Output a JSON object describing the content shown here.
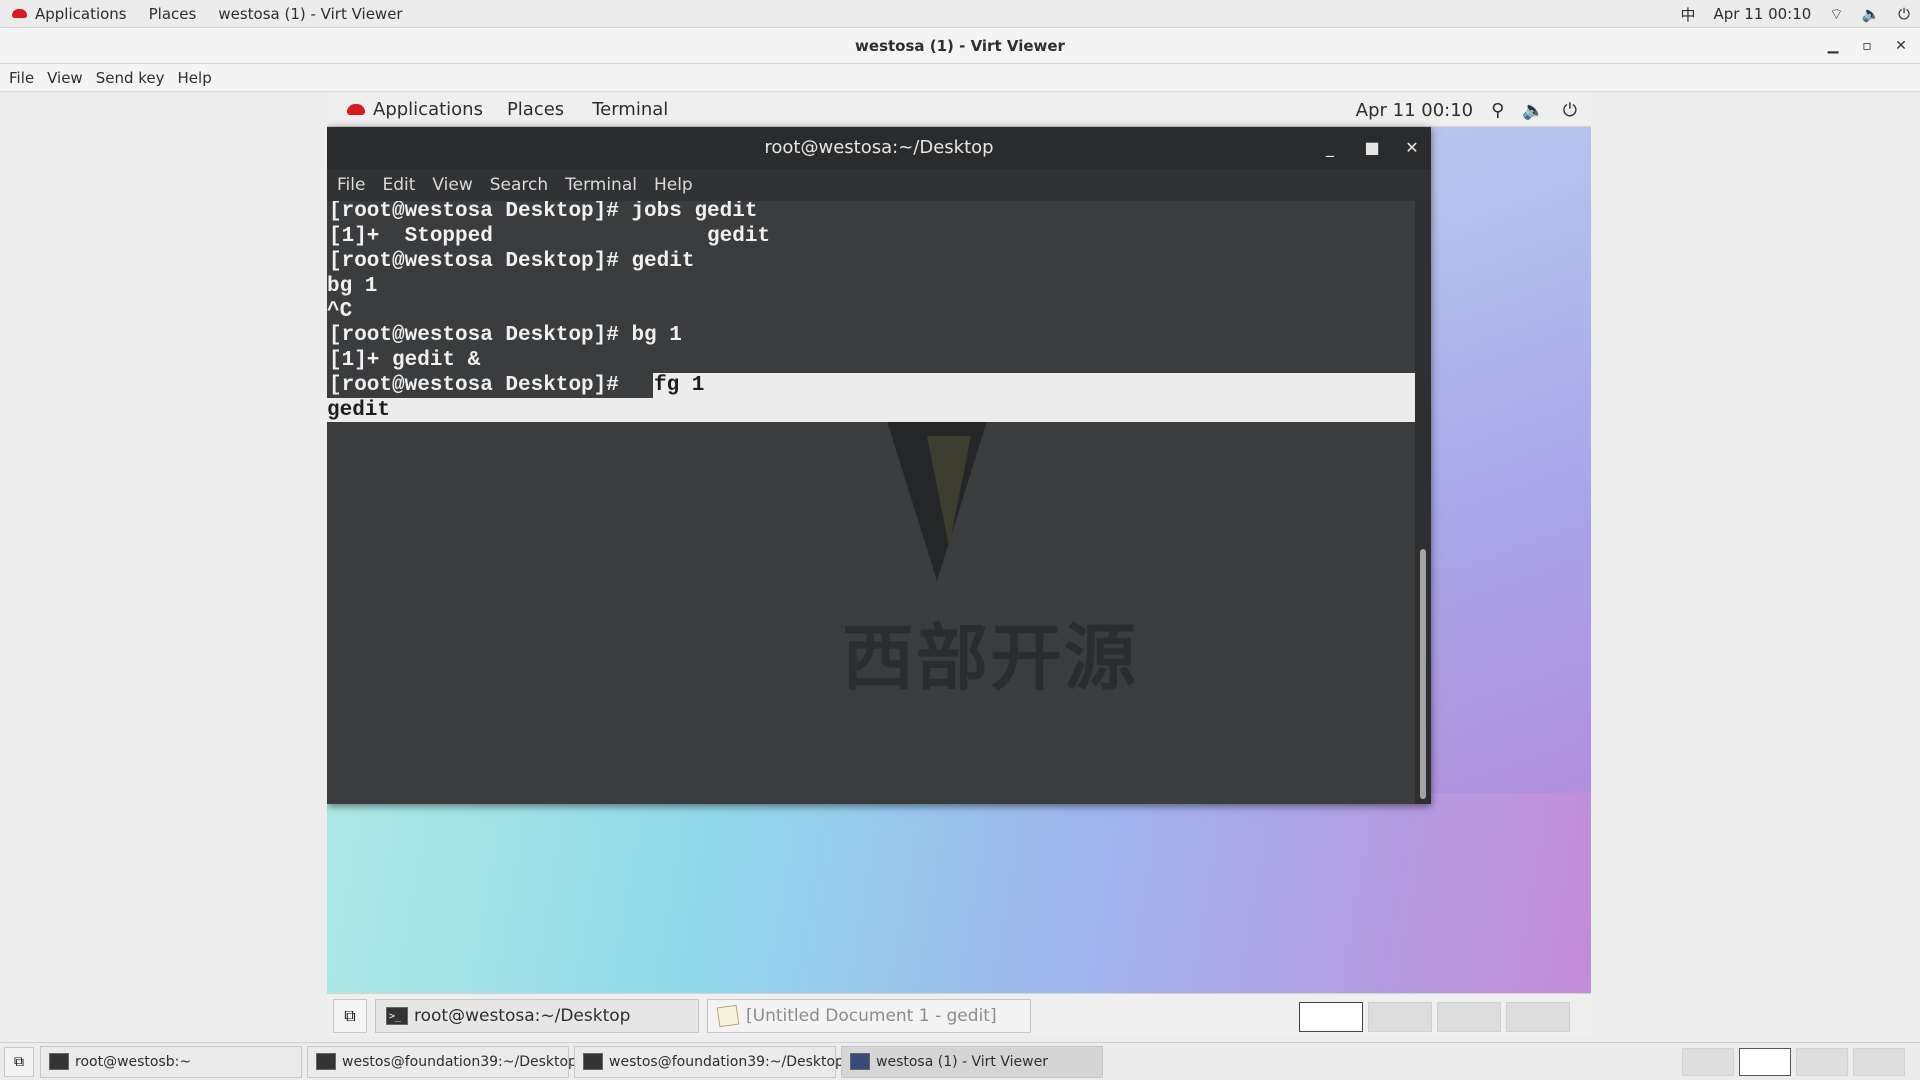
{
  "host_topbar": {
    "applications": "Applications",
    "places": "Places",
    "window_title": "westosa (1) - Virt Viewer",
    "input_method": "中",
    "datetime": "Apr 11  00:10"
  },
  "viewer": {
    "title": "westosa (1) - Virt Viewer",
    "menu": [
      "File",
      "View",
      "Send key",
      "Help"
    ]
  },
  "guest_topbar": {
    "applications": "Applications",
    "places": "Places",
    "terminal": "Terminal",
    "datetime": "Apr 11  00:10"
  },
  "terminal": {
    "title": "root@westosa:~/Desktop",
    "menu": [
      "File",
      "Edit",
      "View",
      "Search",
      "Terminal",
      "Help"
    ],
    "lines": [
      "[root@westosa Desktop]# jobs gedit",
      "[1]+  Stopped                 gedit",
      "[root@westosa Desktop]# gedit",
      "bg 1",
      "^C",
      "[root@westosa Desktop]# bg 1",
      "[1]+ gedit &",
      "[root@westosa Desktop]# ",
      "fg 1",
      "gedit"
    ],
    "watermark": "西部开源"
  },
  "guest_taskbar": {
    "tasks": [
      "root@westosa:~/Desktop",
      "[Untitled Document 1 - gedit]"
    ]
  },
  "host_taskbar": {
    "tasks": [
      "root@westosb:~",
      "westos@foundation39:~/Desktop",
      "westos@foundation39:~/Desktop",
      "westosa (1) - Virt Viewer"
    ]
  }
}
